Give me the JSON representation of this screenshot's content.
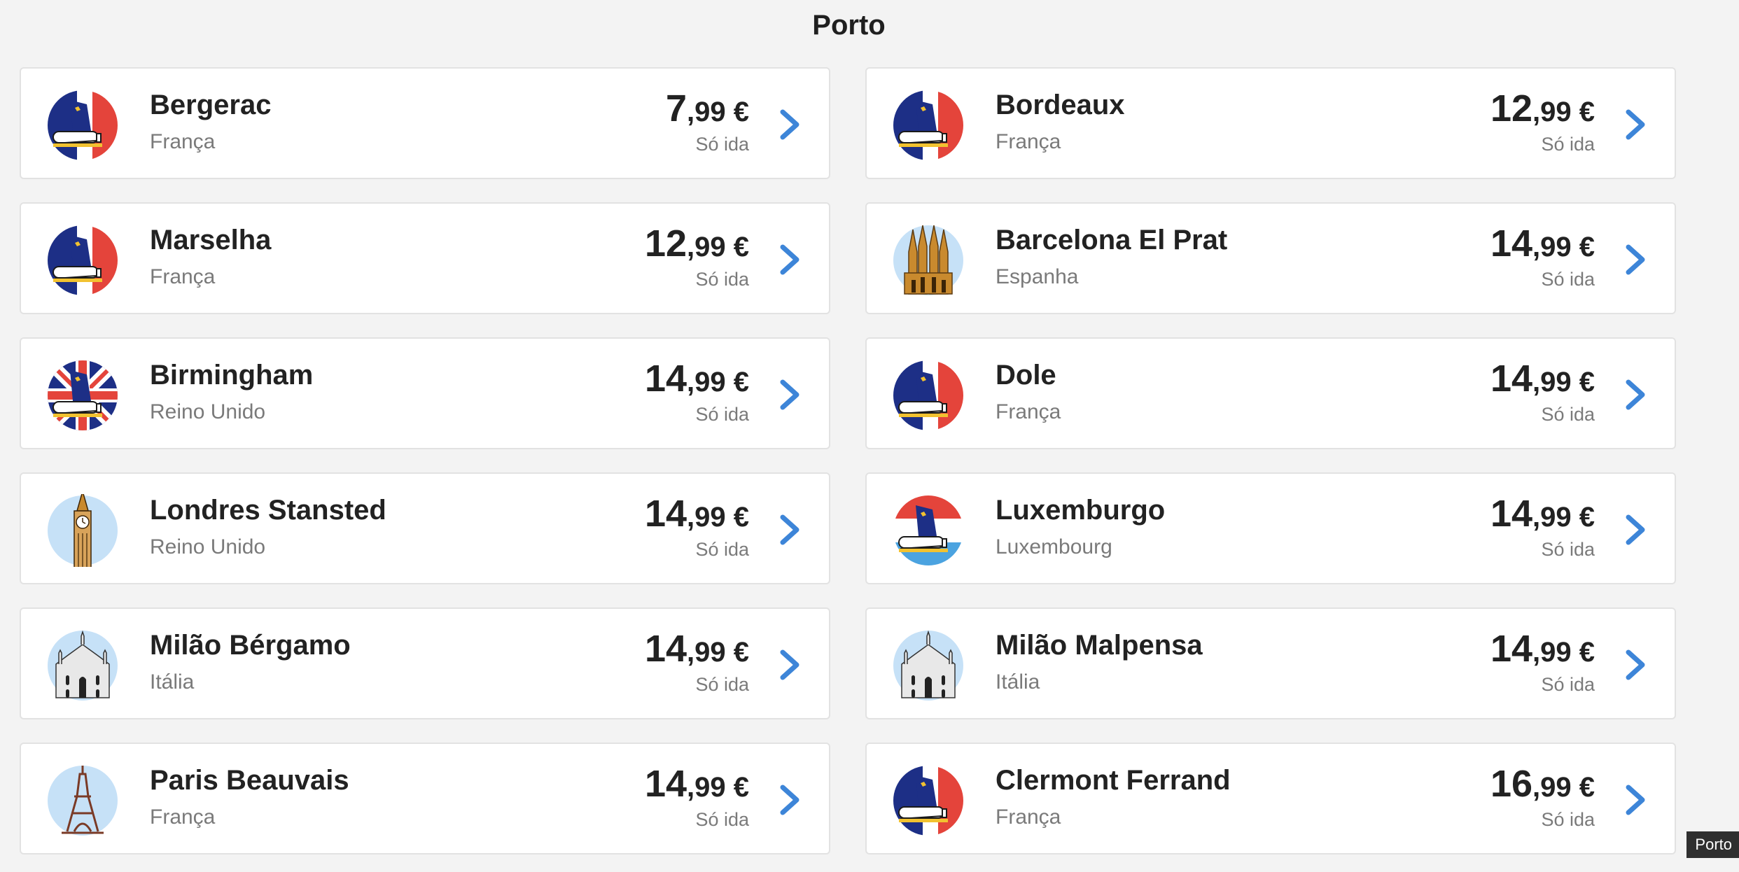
{
  "header": {
    "title": "Porto"
  },
  "colors": {
    "accent": "#3d85d8",
    "card_bg": "#ffffff",
    "page_bg": "#f3f3f3",
    "text_primary": "#222222",
    "text_secondary": "#7a7a7a"
  },
  "destinations": [
    {
      "city": "Bergerac",
      "country": "França",
      "price_int": "7",
      "price_dec": ",99 €",
      "fare_type": "Só ida",
      "icon": "plane-france-icon"
    },
    {
      "city": "Bordeaux",
      "country": "França",
      "price_int": "12",
      "price_dec": ",99 €",
      "fare_type": "Só ida",
      "icon": "plane-france-icon"
    },
    {
      "city": "Marselha",
      "country": "França",
      "price_int": "12",
      "price_dec": ",99 €",
      "fare_type": "Só ida",
      "icon": "plane-france-icon"
    },
    {
      "city": "Barcelona El Prat",
      "country": "Espanha",
      "price_int": "14",
      "price_dec": ",99 €",
      "fare_type": "Só ida",
      "icon": "sagrada-familia-icon"
    },
    {
      "city": "Birmingham",
      "country": "Reino Unido",
      "price_int": "14",
      "price_dec": ",99 €",
      "fare_type": "Só ida",
      "icon": "plane-uk-icon"
    },
    {
      "city": "Dole",
      "country": "França",
      "price_int": "14",
      "price_dec": ",99 €",
      "fare_type": "Só ida",
      "icon": "plane-france-icon"
    },
    {
      "city": "Londres Stansted",
      "country": "Reino Unido",
      "price_int": "14",
      "price_dec": ",99 €",
      "fare_type": "Só ida",
      "icon": "big-ben-icon"
    },
    {
      "city": "Luxemburgo",
      "country": "Luxembourg",
      "price_int": "14",
      "price_dec": ",99 €",
      "fare_type": "Só ida",
      "icon": "plane-luxembourg-icon"
    },
    {
      "city": "Milão Bérgamo",
      "country": "Itália",
      "price_int": "14",
      "price_dec": ",99 €",
      "fare_type": "Só ida",
      "icon": "milan-cathedral-icon"
    },
    {
      "city": "Milão Malpensa",
      "country": "Itália",
      "price_int": "14",
      "price_dec": ",99 €",
      "fare_type": "Só ida",
      "icon": "milan-cathedral-icon"
    },
    {
      "city": "Paris Beauvais",
      "country": "França",
      "price_int": "14",
      "price_dec": ",99 €",
      "fare_type": "Só ida",
      "icon": "eiffel-tower-icon"
    },
    {
      "city": "Clermont Ferrand",
      "country": "França",
      "price_int": "16",
      "price_dec": ",99 €",
      "fare_type": "Só ida",
      "icon": "plane-france-icon"
    }
  ],
  "tooltip": {
    "text": "Porto"
  }
}
